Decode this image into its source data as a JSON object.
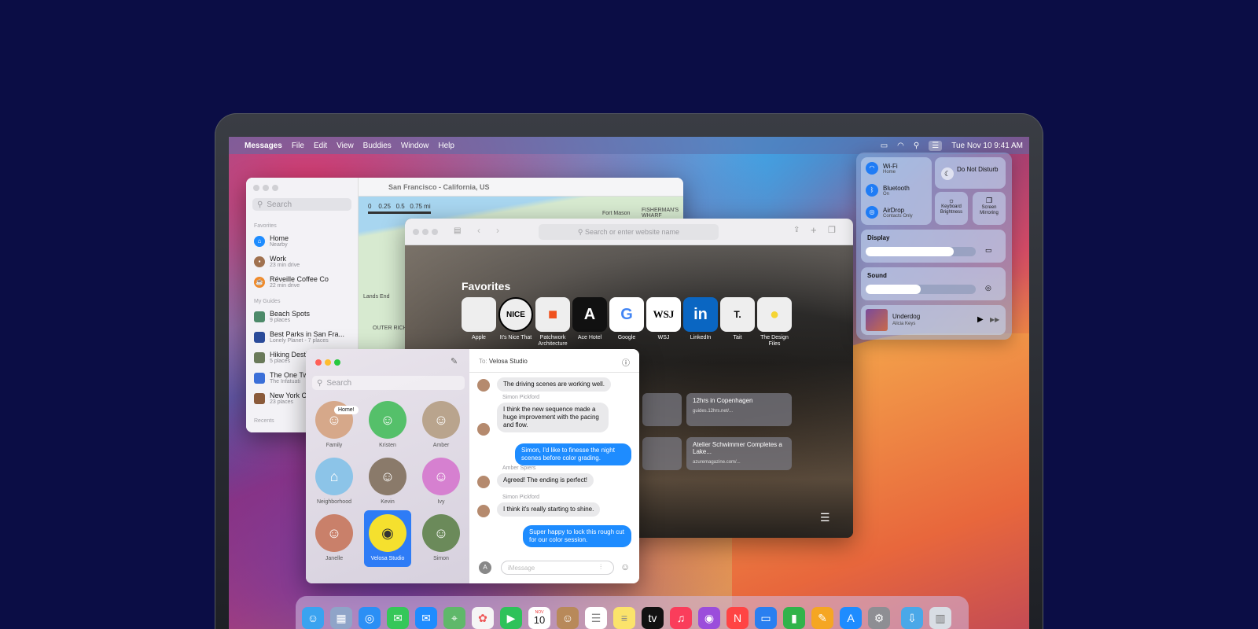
{
  "menubar": {
    "apple": "",
    "app": "Messages",
    "menus": [
      "File",
      "Edit",
      "View",
      "Buddies",
      "Window",
      "Help"
    ],
    "datetime": "Tue Nov 10  9:41 AM"
  },
  "maps": {
    "search_placeholder": "Search",
    "title": "San Francisco - California, US",
    "favorites_label": "Favorites",
    "guides_label": "My Guides",
    "recents_label": "Recents",
    "favorites": [
      {
        "name": "Home",
        "sub": "Nearby"
      },
      {
        "name": "Work",
        "sub": "23 min drive"
      },
      {
        "name": "Réveille Coffee Co",
        "sub": "22 min drive"
      }
    ],
    "guides": [
      {
        "name": "Beach Spots",
        "sub": "9 places"
      },
      {
        "name": "Best Parks in San Fra...",
        "sub": "Lonely Planet - 7 places"
      },
      {
        "name": "Hiking Desti",
        "sub": "5 places"
      },
      {
        "name": "The One Tw",
        "sub": "The Infatuati"
      },
      {
        "name": "New York C",
        "sub": "23 places"
      }
    ],
    "scale_labels": [
      "0",
      "0.25",
      "0.5",
      "0.75 mi"
    ],
    "map_labels": [
      "Fort Mason",
      "FISHERMAN'S WHARF",
      "Lands End",
      "OUTER RICHMOND"
    ]
  },
  "safari": {
    "url_placeholder": "Search or enter website name",
    "favorites_title": "Favorites",
    "favorites": [
      {
        "label": "Apple",
        "glyph": ""
      },
      {
        "label": "It's Nice That",
        "glyph": "NICE"
      },
      {
        "label": "Patchwork Architecture",
        "glyph": "■"
      },
      {
        "label": "Ace Hotel",
        "glyph": "A"
      },
      {
        "label": "Google",
        "glyph": "G"
      },
      {
        "label": "WSJ",
        "glyph": "WSJ"
      },
      {
        "label": "LinkedIn",
        "glyph": "in"
      },
      {
        "label": "Tait",
        "glyph": "T."
      },
      {
        "label": "The Design Files",
        "glyph": "●"
      }
    ],
    "cards": [
      {
        "title": "12hrs in Copenhagen",
        "url": "guides.12hrs.net/..."
      },
      {
        "title": "Atelier Schwimmer Completes a Lake...",
        "url": "azuremagazine.com/..."
      }
    ]
  },
  "messages": {
    "search_placeholder": "Search",
    "to_label": "To:",
    "to_name": "Velosa Studio",
    "input_placeholder": "iMessage",
    "pins": [
      {
        "name": "Family",
        "bubble": "Home!"
      },
      {
        "name": "Kristen"
      },
      {
        "name": "Amber"
      },
      {
        "name": "Neighborhood"
      },
      {
        "name": "Kevin"
      },
      {
        "name": "Ivy"
      },
      {
        "name": "Janelle"
      },
      {
        "name": "Velosa Studio"
      },
      {
        "name": "Simon"
      }
    ],
    "thread": [
      {
        "text": "The driving scenes are working well."
      },
      {
        "sender": "Simon Pickford",
        "text": "I think the new sequence made a huge improvement with the pacing and flow."
      },
      {
        "text": "Simon, I'd like to finesse the night scenes before color grading."
      },
      {
        "sender": "Amber Spiers",
        "text": "Agreed! The ending is perfect!"
      },
      {
        "sender": "Simon Pickford",
        "text": "I think it's really starting to shine."
      },
      {
        "text": "Super happy to lock this rough cut for our color session."
      }
    ]
  },
  "control_center": {
    "wifi": {
      "name": "Wi-Fi",
      "sub": "Home"
    },
    "bluetooth": {
      "name": "Bluetooth",
      "sub": "On"
    },
    "airdrop": {
      "name": "AirDrop",
      "sub": "Contacts Only"
    },
    "dnd": "Do Not Disturb",
    "keyboard": "Keyboard Brightness",
    "mirroring": "Screen Mirroring",
    "display_label": "Display",
    "sound_label": "Sound",
    "display_level": 0.8,
    "sound_level": 0.5,
    "now_playing": {
      "title": "Underdog",
      "artist": "Alicia Keys"
    }
  },
  "dock": {
    "calendar_month": "NOV",
    "calendar_day": "10"
  },
  "colors": {
    "background": "#0b0d45",
    "accent": "#1e8cff",
    "selected": "#2e7cf6"
  }
}
